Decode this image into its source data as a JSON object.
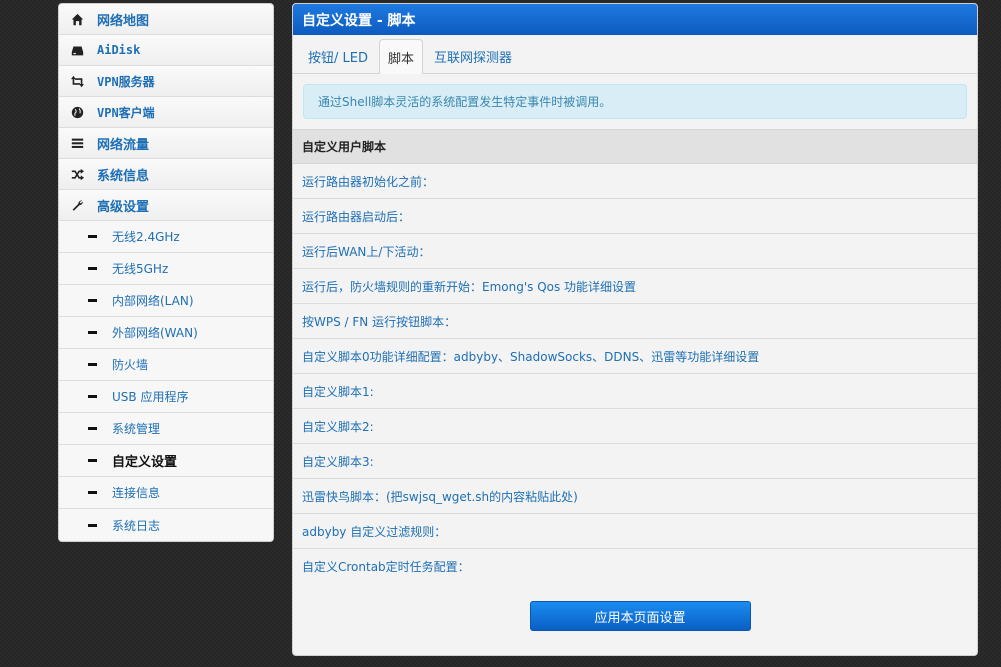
{
  "sidebar": {
    "items": [
      {
        "label": "网络地图",
        "icon": "home-icon"
      },
      {
        "label": "AiDisk",
        "icon": "hdd-icon"
      },
      {
        "label": "VPN服务器",
        "icon": "retweet-icon"
      },
      {
        "label": "VPN客户端",
        "icon": "globe-icon"
      },
      {
        "label": "网络流量",
        "icon": "list-icon"
      },
      {
        "label": "系统信息",
        "icon": "random-icon"
      },
      {
        "label": "高级设置",
        "icon": "wrench-icon"
      }
    ],
    "subitems": [
      {
        "label": "无线2.4GHz"
      },
      {
        "label": "无线5GHz"
      },
      {
        "label": "内部网络(LAN)"
      },
      {
        "label": "外部网络(WAN)"
      },
      {
        "label": "防火墙"
      },
      {
        "label": "USB 应用程序"
      },
      {
        "label": "系统管理"
      },
      {
        "label": "自定义设置",
        "active": true
      },
      {
        "label": "连接信息"
      },
      {
        "label": "系统日志"
      }
    ]
  },
  "panel": {
    "title": "自定义设置 - 脚本",
    "tabs": [
      {
        "label": "按钮/ LED"
      },
      {
        "label": "脚本",
        "active": true
      },
      {
        "label": "互联网探测器"
      }
    ],
    "alert": "通过Shell脚本灵活的系统配置发生特定事件时被调用。",
    "section_title": "自定义用户脚本",
    "rows": [
      "运行路由器初始化之前：",
      "运行路由器启动后：",
      "运行后WAN上/下活动：",
      "运行后，防火墙规则的重新开始：Emong's Qos 功能详细设置",
      "按WPS / FN 运行按钮脚本：",
      "自定义脚本0功能详细配置：adbyby、ShadowSocks、DDNS、迅雷等功能详细设置",
      "自定义脚本1:",
      "自定义脚本2:",
      "自定义脚本3:",
      "迅雷快鸟脚本：(把swjsq_wget.sh的内容粘贴此处)",
      "adbyby 自定义过滤规则：",
      "自定义Crontab定时任务配置："
    ],
    "apply_button": "应用本页面设置"
  },
  "colors": {
    "accent": "#1e6fb5",
    "header_blue": "#0d5bbf",
    "alert_bg": "#d9edf7"
  }
}
